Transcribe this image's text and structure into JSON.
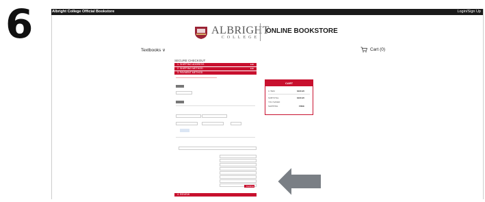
{
  "step_number": "6",
  "topbar": {
    "site_name": "Albright College Official Bookstore",
    "login": "Login/Sign Up"
  },
  "header": {
    "logo_main": "ALBRIGHT",
    "logo_sub": "COLLEGE",
    "store_title": "ONLINE BOOKSTORE"
  },
  "nav": {
    "textbooks": "Textbooks ∨",
    "cart": "Cart (0)"
  },
  "checkout": {
    "title": "SECURE CHECKOUT",
    "steps": [
      {
        "label": "1. SHIPPING ADDRESS",
        "edit": "Edit"
      },
      {
        "label": "2. SHIPPING METHOD",
        "edit": "Edit"
      },
      {
        "label": "3. PAYMENT METHOD",
        "edit": ""
      }
    ],
    "review_step": "4. REVIEW",
    "continue_label": "Continue"
  },
  "cart_summary": {
    "title": "CART",
    "rows": [
      {
        "label": "1 ITEM",
        "value": "$160.95"
      },
      {
        "label": "SUBTOTAL",
        "value": "$160.95"
      },
      {
        "label": "YOU SAVED",
        "value": ""
      },
      {
        "label": "SHIPPING",
        "value": "FREE"
      }
    ]
  },
  "colors": {
    "accent": "#c8102e",
    "topbar": "#1a1a1a",
    "arrow": "#7a7f85"
  }
}
